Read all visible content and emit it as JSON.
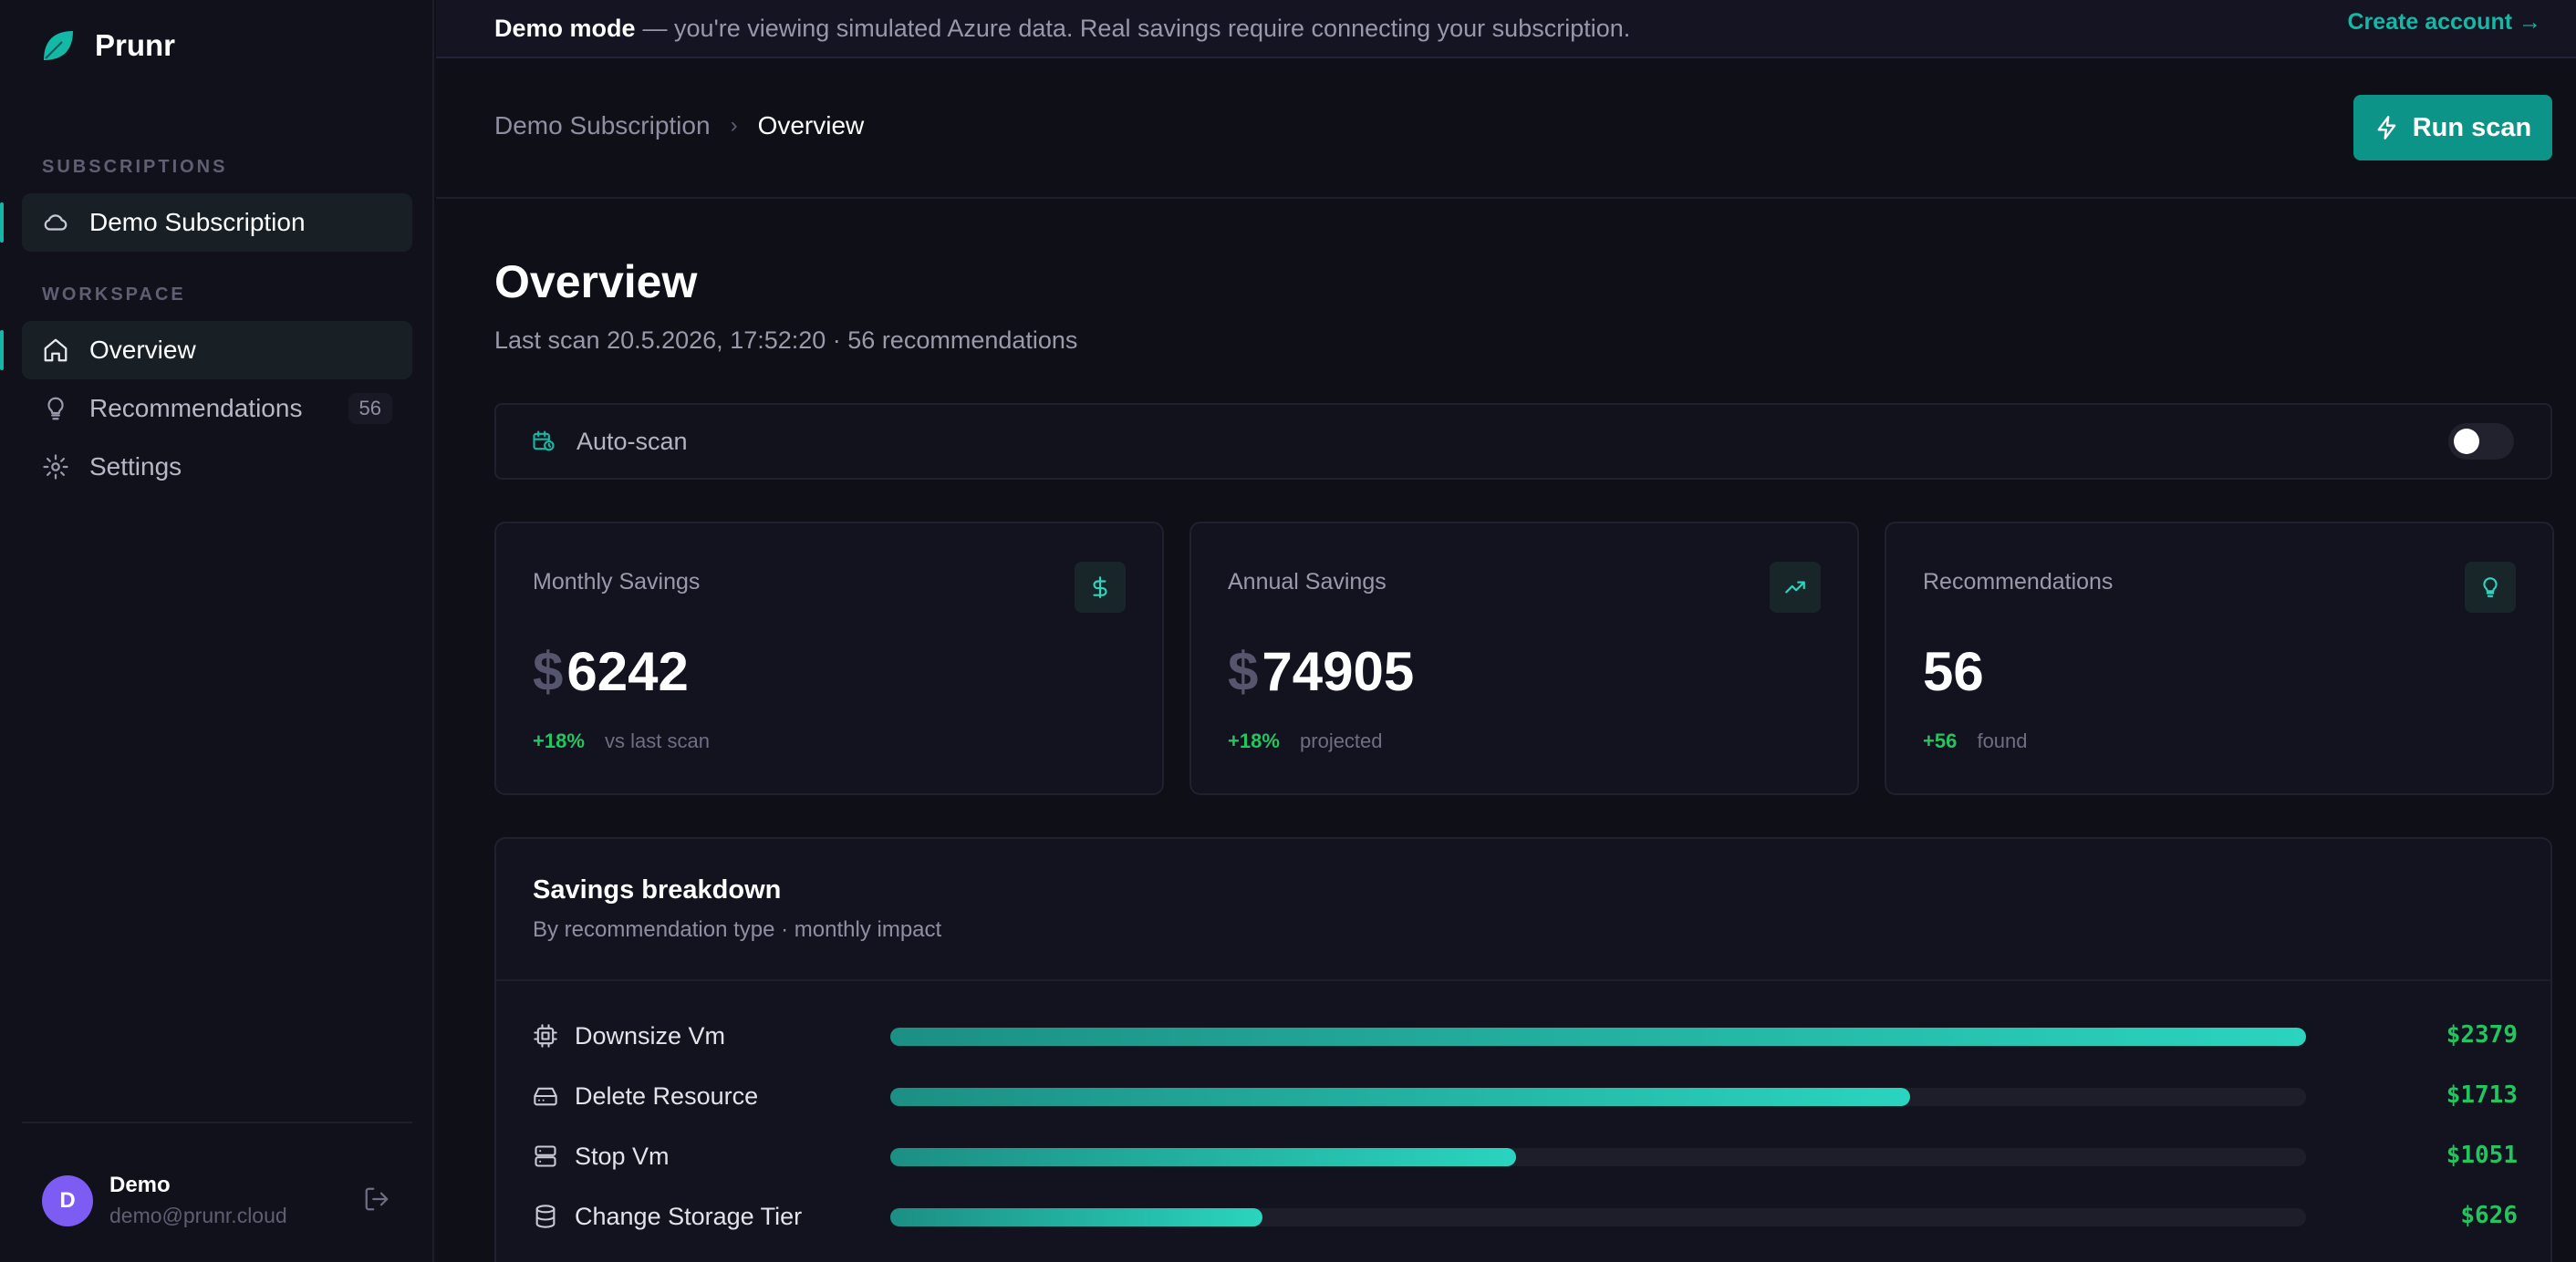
{
  "app": {
    "name": "Prunr"
  },
  "sidebar": {
    "subscriptions_label": "SUBSCRIPTIONS",
    "subscription": "Demo Subscription",
    "workspace_label": "WORKSPACE",
    "items": [
      {
        "label": "Overview",
        "icon": "home-icon",
        "active": true
      },
      {
        "label": "Recommendations",
        "icon": "lightbulb-icon",
        "badge": "56"
      },
      {
        "label": "Settings",
        "icon": "gear-icon"
      }
    ],
    "user": {
      "initial": "D",
      "name": "Demo",
      "email": "demo@prunr.cloud"
    }
  },
  "banner": {
    "strong": "Demo mode",
    "text": "— you're viewing simulated Azure data. Real savings require connecting your subscription.",
    "link": "Create account →"
  },
  "topbar": {
    "breadcrumb_parent": "Demo Subscription",
    "breadcrumb_sep": "›",
    "breadcrumb_current": "Overview",
    "run_scan": "Run scan"
  },
  "page": {
    "title": "Overview",
    "subtitle": "Last scan 20.5.2026, 17:52:20 · 56 recommendations"
  },
  "autoscan": {
    "label": "Auto-scan",
    "enabled": false
  },
  "cards": [
    {
      "label": "Monthly Savings",
      "currency": "$",
      "value": "6242",
      "delta": "+18%",
      "note": "vs last scan",
      "icon": "dollar-icon"
    },
    {
      "label": "Annual Savings",
      "currency": "$",
      "value": "74905",
      "delta": "+18%",
      "note": "projected",
      "icon": "trending-up-icon"
    },
    {
      "label": "Recommendations",
      "currency": "",
      "value": "56",
      "delta": "+56",
      "note": "found",
      "icon": "lightbulb-icon"
    }
  ],
  "breakdown": {
    "title": "Savings breakdown",
    "subtitle": "By recommendation type · monthly impact",
    "rows": [
      {
        "label": "Downsize Vm",
        "icon": "cpu-icon",
        "amount": 2379,
        "display": "$2379"
      },
      {
        "label": "Delete Resource",
        "icon": "hard-drive-icon",
        "amount": 1713,
        "display": "$1713"
      },
      {
        "label": "Stop Vm",
        "icon": "server-icon",
        "amount": 1051,
        "display": "$1051"
      },
      {
        "label": "Change Storage Tier",
        "icon": "database-icon",
        "amount": 626,
        "display": "$626"
      }
    ]
  },
  "colors": {
    "accent": "#14b8a6",
    "positive": "#22c55e",
    "background": "#0f0f17"
  }
}
